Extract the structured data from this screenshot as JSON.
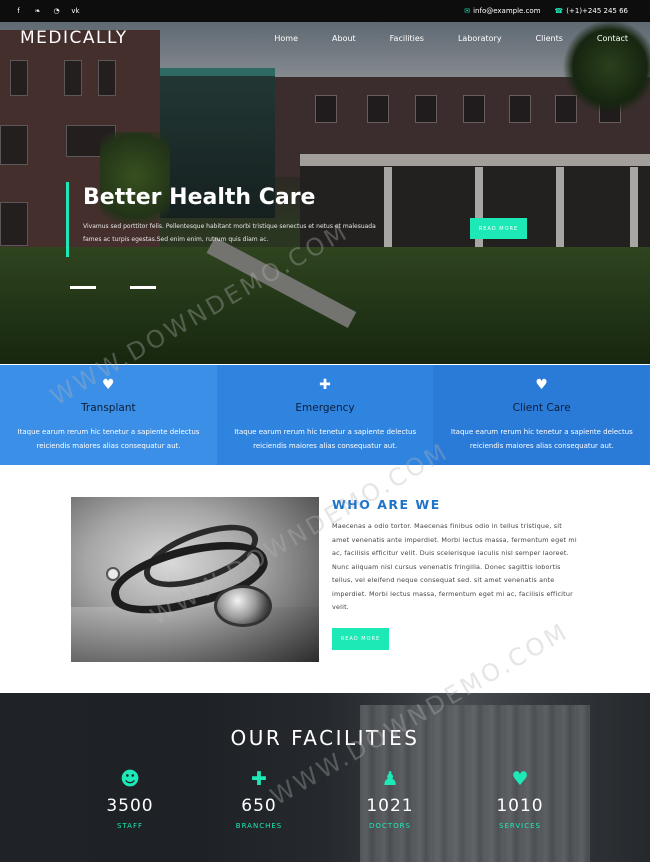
{
  "topbar": {
    "social": [
      {
        "icon": "facebook-icon",
        "glyph": "f"
      },
      {
        "icon": "twitter-icon",
        "glyph": "❧"
      },
      {
        "icon": "rss-icon",
        "glyph": "◔"
      },
      {
        "icon": "vk-icon",
        "glyph": "vk"
      }
    ],
    "email": "info@example.com",
    "phone": "(+1)+245 245 66"
  },
  "nav": {
    "logo": "MEDICALLY",
    "items": [
      "Home",
      "About",
      "Facilities",
      "Laboratory",
      "Clients",
      "Contact"
    ]
  },
  "hero": {
    "title": "Better Health Care",
    "text": "Vivamus sed porttitor felis. Pellentesque habitant morbi tristique senectus et netus et malesuada fames ac turpis egestas.Sed enim enim, rutrum quis diam ac.",
    "button": "READ MORE"
  },
  "services": [
    {
      "icon": "heart-icon",
      "glyph": "♥",
      "title": "Transplant",
      "text": "Itaque earum rerum hic tenetur a sapiente delectus reiciendis maiores alias consequatur aut."
    },
    {
      "icon": "ambulance-icon",
      "glyph": "✚",
      "title": "Emergency",
      "text": "Itaque earum rerum hic tenetur a sapiente delectus reiciendis maiores alias consequatur aut."
    },
    {
      "icon": "heartbeat-icon",
      "glyph": "♥",
      "title": "Client Care",
      "text": "Itaque earum rerum hic tenetur a sapiente delectus reiciendis maiores alias consequatur aut."
    }
  ],
  "about": {
    "title": "WHO ARE WE",
    "text": "Maecenas a odio tortor. Maecenas finibus odio in tellus tristique, sit amet venenatis ante imperdiet. Morbi lectus massa, fermentum eget mi ac, facilisis efficitur velit. Duis scelerisque iaculis nisl semper laoreet. Nunc aliquam nisl cursus venenatis fringilla. Donec sagittis lobortis tellus, vel eleifend neque consequat sed. sit amet venenatis ante imperdiet. Morbi lectus massa, fermentum eget mi ac, facilisis efficitur velit.",
    "button": "READ MORE"
  },
  "facilities": {
    "title": "OUR FACILITIES",
    "stats": [
      {
        "icon": "users-icon",
        "glyph": "☻",
        "number": "3500",
        "label": "STAFF"
      },
      {
        "icon": "medkit-icon",
        "glyph": "✚",
        "number": "650",
        "label": "BRANCHES"
      },
      {
        "icon": "doctor-icon",
        "glyph": "♟",
        "number": "1021",
        "label": "DOCTORS"
      },
      {
        "icon": "heart-icon",
        "glyph": "♥",
        "number": "1010",
        "label": "SERVICES"
      }
    ]
  },
  "watermark": "WWW.DOWNDEMO.COM",
  "colors": {
    "accent": "#1de9b6",
    "blue_left": "#3c8fe6",
    "blue_mid": "#2f84e0",
    "blue_right": "#2a7ad8",
    "title_blue": "#1e74c8"
  }
}
